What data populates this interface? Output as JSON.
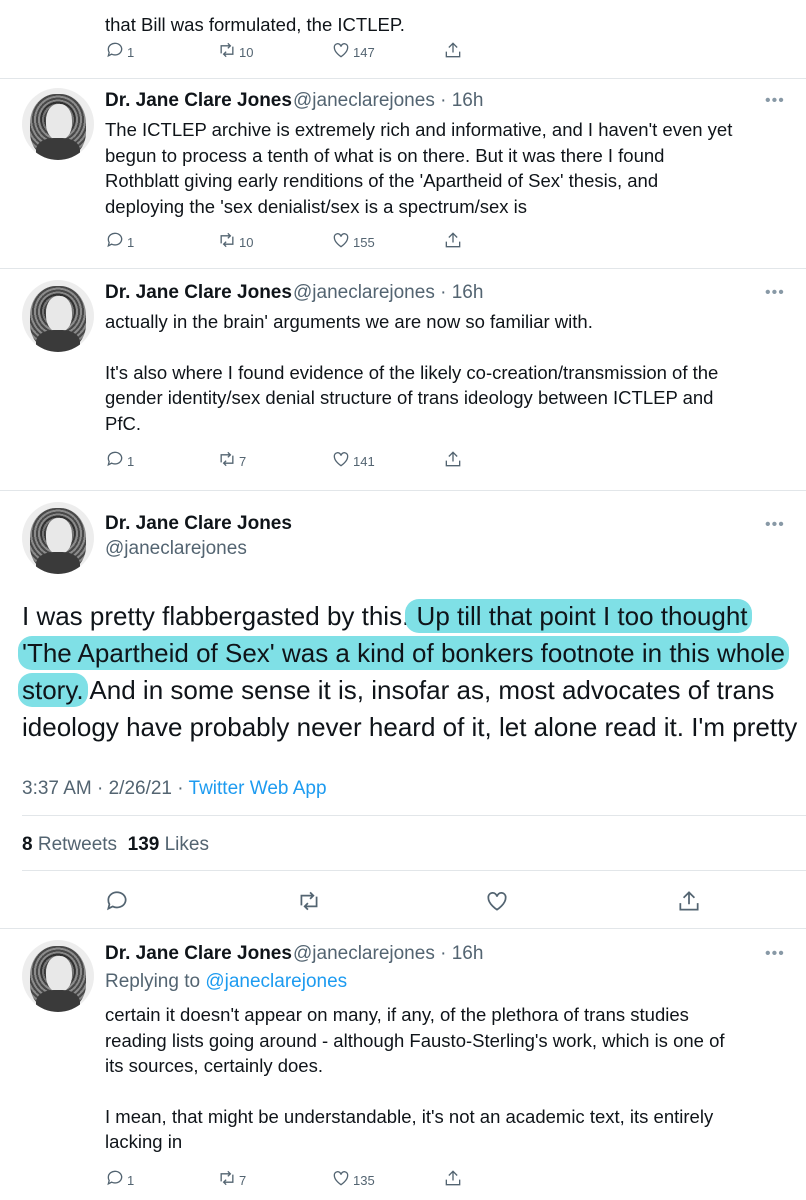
{
  "tweet0": {
    "text": "that Bill was formulated, the ICTLEP.",
    "replies": "1",
    "retweets": "10",
    "likes": "147"
  },
  "tweet1": {
    "name": "Dr. Jane Clare Jones",
    "handle_time": "@janeclarejones · 16h",
    "lines": [
      "The ICTLEP archive is extremely rich and informative, and I haven't even yet",
      "begun to process a tenth of what is on there. But it was there I found",
      "Rothblatt giving early renditions of the 'Apartheid of Sex' thesis, and",
      "deploying the 'sex denialist/sex is a spectrum/sex is"
    ],
    "replies": "1",
    "retweets": "10",
    "likes": "155"
  },
  "tweet2": {
    "name": "Dr. Jane Clare Jones",
    "handle_time": "@janeclarejones · 16h",
    "line1": "actually in the brain' arguments we are now so familiar with.",
    "lines": [
      "It's also where I found evidence of the likely co-creation/transmission of the",
      "gender identity/sex denial structure of trans ideology between ICTLEP and",
      "PfC."
    ],
    "replies": "1",
    "retweets": "7",
    "likes": "141"
  },
  "main": {
    "name": "Dr. Jane Clare Jones",
    "handle": "@janeclarejones",
    "line1_plain": "I was pretty flabbergasted by this.",
    "line1_hl": " Up till that point I too thought",
    "line2_hl": "'The Apartheid of Sex' was a kind of bonkers footnote in this whole",
    "line3_hl": "story.",
    "line3_plain": " And in some sense it is, insofar as, most advocates of trans",
    "line4": "ideology have probably never heard of it, let alone read it. I'm pretty",
    "time": "3:37 AM · 2/26/21 · ",
    "app": "Twitter Web App",
    "retweets_count": "8",
    "retweets_label": " Retweets  ",
    "likes_count": "139",
    "likes_label": " Likes"
  },
  "tweet3": {
    "name": "Dr. Jane Clare Jones",
    "handle_time": "@janeclarejones · 16h",
    "replying_prefix": "Replying to ",
    "replying_handle": "@janeclarejones",
    "lines": [
      "certain it doesn't appear on many, if any, of the plethora of trans studies",
      "reading lists going around - although Fausto-Sterling's work, which is one of",
      "its sources, certainly does."
    ],
    "lines2": [
      "I mean, that might be understandable, it's not an academic text, its entirely",
      "lacking in"
    ],
    "replies": "1",
    "retweets": "7",
    "likes": "135"
  },
  "more_glyph": "•••",
  "colors": {
    "highlight": "#7fe0e6",
    "link": "#1d9bf0",
    "muted": "#536471"
  }
}
